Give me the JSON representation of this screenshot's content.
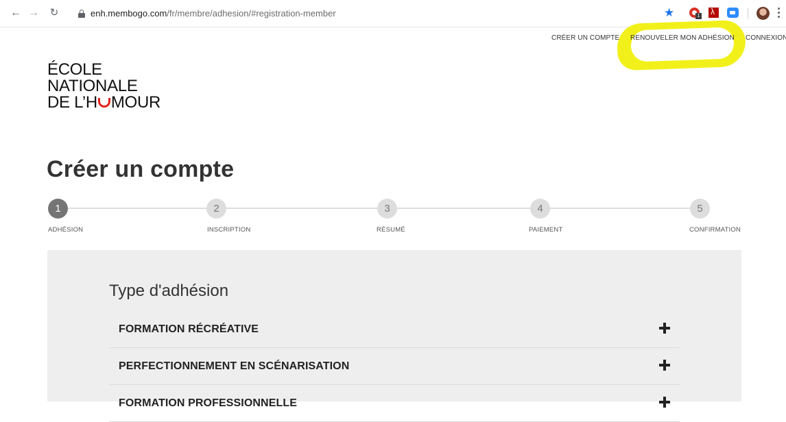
{
  "browser": {
    "url_host": "enh.membogo.com",
    "url_path": "/fr/membre/adhesion/#registration-member",
    "extension_badge": "1"
  },
  "site_nav": {
    "create_account": "CRÉER UN COMPTE",
    "renew_membership": "RENOUVELER MON ADHÉSION",
    "login": "CONNEXION"
  },
  "logo": {
    "line1": "ÉCOLE",
    "line2": "NATIONALE",
    "line3_a": "DE L’H",
    "line3_b": "MOUR"
  },
  "page": {
    "title": "Créer un compte"
  },
  "steps": [
    {
      "number": "1",
      "label": "ADHÉSION"
    },
    {
      "number": "2",
      "label": "INSCRIPTION"
    },
    {
      "number": "3",
      "label": "RÉSUMÉ"
    },
    {
      "number": "4",
      "label": "PAIEMENT"
    },
    {
      "number": "5",
      "label": "CONFIRMATION"
    }
  ],
  "membership": {
    "heading": "Type d'adhésion",
    "types": [
      {
        "label": "FORMATION RÉCRÉATIVE"
      },
      {
        "label": "PERFECTIONNEMENT EN SCÉNARISATION"
      },
      {
        "label": "FORMATION PROFESSIONNELLE"
      }
    ]
  },
  "colors": {
    "highlight": "#f2f01a",
    "logo_accent": "#e2231a",
    "active_step": "#757575",
    "panel_bg": "#eeeeee"
  }
}
